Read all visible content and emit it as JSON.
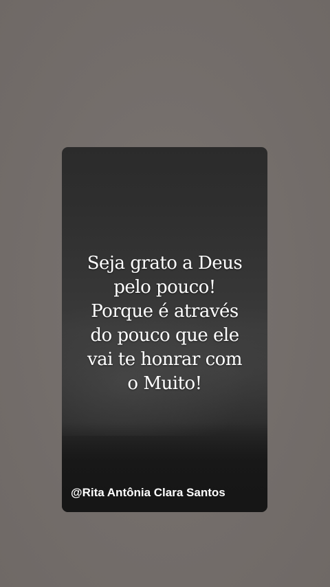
{
  "quote": {
    "lines": [
      "Seja grato a Deus",
      " pelo pouco!",
      "Porque é através",
      "do pouco que ele",
      "vai te honrar com",
      "o Muito!"
    ]
  },
  "author": "@Rita Antônia Clara Santos"
}
